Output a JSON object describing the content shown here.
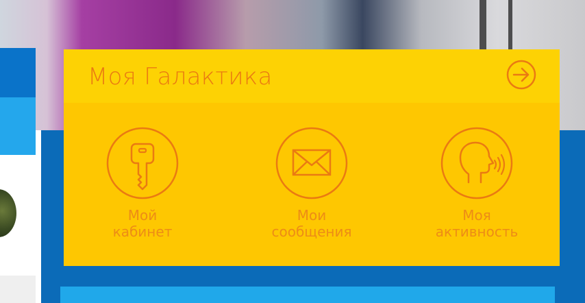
{
  "widget": {
    "title": "Моя Галактика",
    "accent_color": "#ea7a12",
    "card_color": "#fec701",
    "header_color": "#fdd204",
    "go_icon": "arrow-circle-right-icon",
    "tiles": [
      {
        "label": "Мой\nкабинет",
        "icon": "key-icon"
      },
      {
        "label": "Мои\nсообщения",
        "icon": "envelope-icon"
      },
      {
        "label": "Моя\nактивность",
        "icon": "speaking-head-icon"
      }
    ]
  },
  "page": {
    "panel_color": "#0b6bb8",
    "secondary_blue": "#20a8ea"
  }
}
